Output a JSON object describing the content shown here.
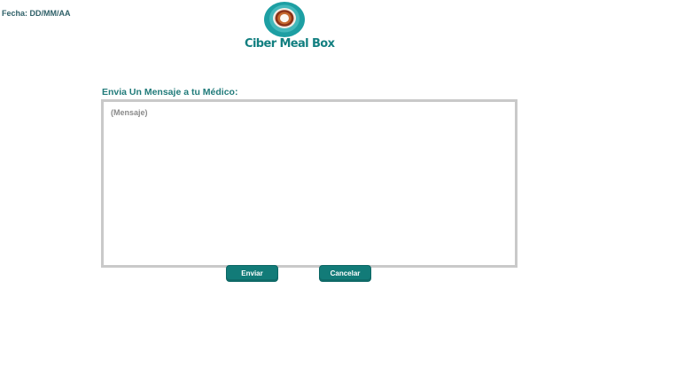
{
  "header": {
    "date_text": "Fecha: DD/MM/AA",
    "logo_text": "Ciber Meal Box"
  },
  "form": {
    "title": "Envia Un Mensaje a tu Médico:",
    "message_placeholder": "(Mensaje)",
    "send_label": "Enviar",
    "cancel_label": "Cancelar"
  },
  "colors": {
    "accent": "#127b78",
    "title": "#217b7a",
    "border": "#c9c9c9"
  }
}
